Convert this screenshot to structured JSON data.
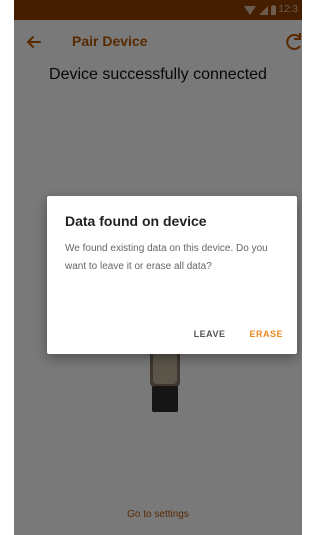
{
  "status_bar": {
    "time": "12:3"
  },
  "app_bar": {
    "title": "Pair Device",
    "back_icon": "back-arrow-icon",
    "refresh_icon": "refresh-icon"
  },
  "main": {
    "heading": "Device successfully connected",
    "footer_link": "Go to settings"
  },
  "dialog": {
    "title": "Data found on device",
    "message": "We found existing data on this device. Do you want to leave it or erase all data?",
    "leave_label": "LEAVE",
    "erase_label": "ERASE"
  },
  "colors": {
    "status_bar": "#8a3c00",
    "accent": "#f08a24",
    "title": "#b35500"
  }
}
